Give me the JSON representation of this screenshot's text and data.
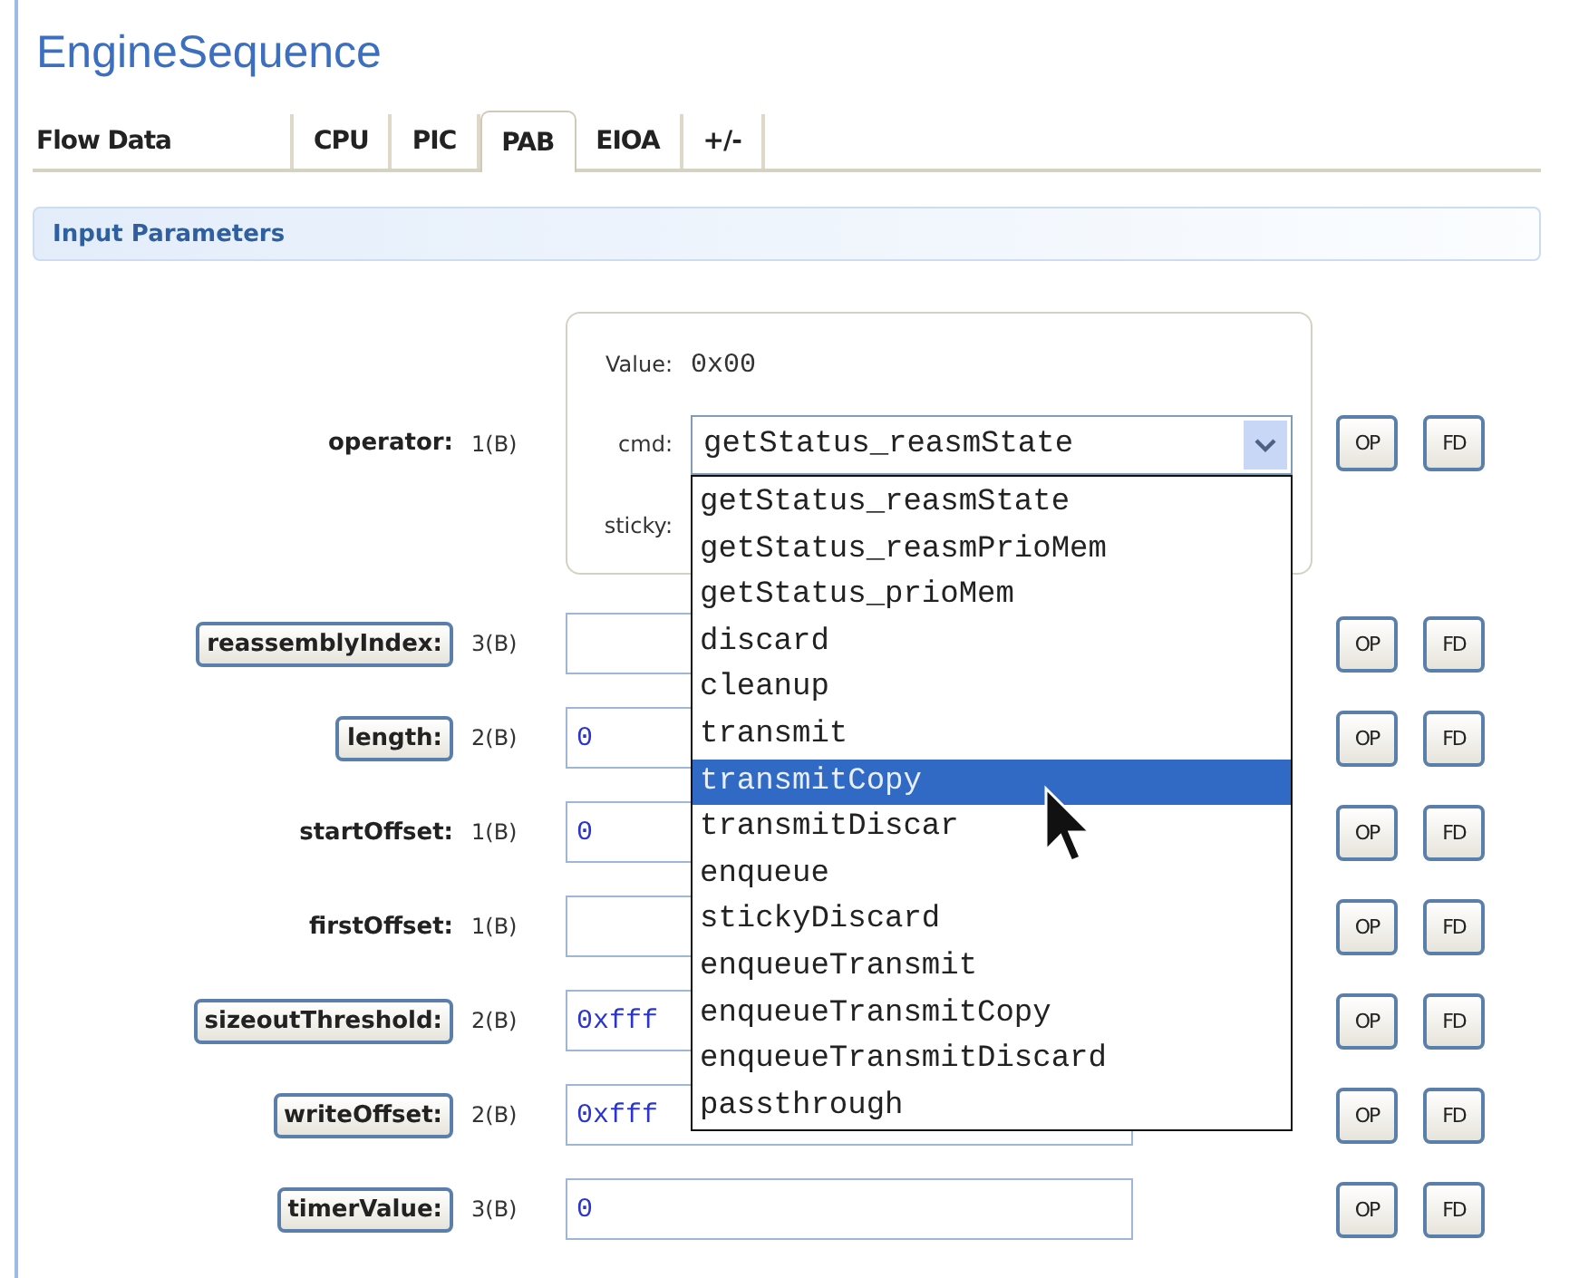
{
  "title": "EngineSequence",
  "tabs": [
    {
      "label": "Flow Data",
      "selected": false
    },
    {
      "label": "CPU",
      "selected": false
    },
    {
      "label": "PIC",
      "selected": false
    },
    {
      "label": "PAB",
      "selected": true
    },
    {
      "label": "EIOA",
      "selected": false
    },
    {
      "label": "+/-",
      "selected": false
    }
  ],
  "section": {
    "title": "Input Parameters"
  },
  "parameters": [
    {
      "kind": "composite",
      "name": "operator:",
      "button": false,
      "size": "1(B)",
      "value_label": "Value:",
      "value": "0x00",
      "cmd_label": "cmd:",
      "cmd": "getStatus_reasmState",
      "sticky_label": "sticky:",
      "actions": [
        "OP",
        "FD"
      ],
      "cmd_options": [
        {
          "label": "getStatus_reasmState",
          "selected": false
        },
        {
          "label": "getStatus_reasmPrioMem",
          "selected": false
        },
        {
          "label": "getStatus_prioMem",
          "selected": false
        },
        {
          "label": "discard",
          "selected": false
        },
        {
          "label": "cleanup",
          "selected": false
        },
        {
          "label": "transmit",
          "selected": false
        },
        {
          "label": "transmitCopy",
          "selected": true
        },
        {
          "label": "transmitDiscar",
          "selected": false
        },
        {
          "label": "enqueue",
          "selected": false
        },
        {
          "label": "stickyDiscard",
          "selected": false
        },
        {
          "label": "enqueueTransmit",
          "selected": false
        },
        {
          "label": "enqueueTransmitCopy",
          "selected": false
        },
        {
          "label": "enqueueTransmitDiscard",
          "selected": false
        },
        {
          "label": "passthrough",
          "selected": false
        }
      ]
    },
    {
      "kind": "field",
      "name": "reassemblyIndex:",
      "button": true,
      "size": "3(B)",
      "actions": [
        "OP",
        "FD"
      ]
    },
    {
      "kind": "field",
      "name": "length:",
      "button": true,
      "size": "2(B)",
      "value": "0",
      "actions": [
        "OP",
        "FD"
      ]
    },
    {
      "kind": "field",
      "name": "startOffset:",
      "button": false,
      "size": "1(B)",
      "value": "0",
      "actions": [
        "OP",
        "FD"
      ]
    },
    {
      "kind": "field",
      "name": "firstOffset:",
      "button": false,
      "size": "1(B)",
      "actions": [
        "OP",
        "FD"
      ]
    },
    {
      "kind": "field",
      "name": "sizeoutThreshold:",
      "button": true,
      "size": "2(B)",
      "value": "0xfff",
      "actions": [
        "OP",
        "FD"
      ]
    },
    {
      "kind": "field",
      "name": "writeOffset:",
      "button": true,
      "size": "2(B)",
      "value": "0xfff",
      "actions": [
        "OP",
        "FD"
      ]
    },
    {
      "kind": "field",
      "name": "timerValue:",
      "button": true,
      "size": "3(B)",
      "value": "0",
      "actions": [
        "OP",
        "FD"
      ]
    }
  ]
}
